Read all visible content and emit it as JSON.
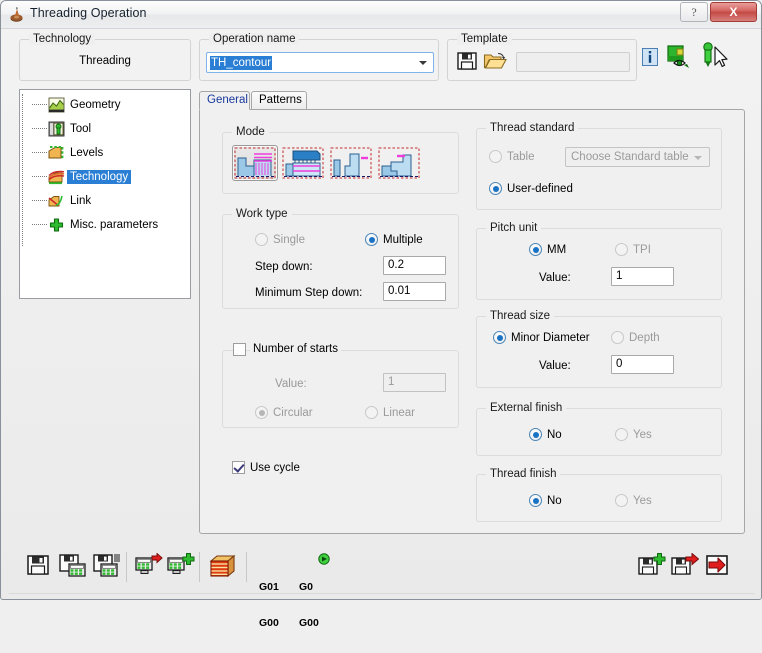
{
  "window": {
    "title": "Threading Operation",
    "icon": "threading-tool-icon",
    "help_label": "?",
    "close_label": "X"
  },
  "header": {
    "technology": {
      "label": "Technology",
      "value": "Threading"
    },
    "operation_name": {
      "label": "Operation name",
      "value": "TH_contour",
      "selected": true
    },
    "template": {
      "label": "Template",
      "field_value": "",
      "save_icon": "save-template-icon",
      "open_icon": "open-template-icon"
    },
    "icons": [
      {
        "name": "info-icon",
        "title": "Info"
      },
      {
        "name": "tool-preview-icon",
        "title": "Tool preview"
      },
      {
        "name": "pick-tool-icon",
        "title": "Pick tool"
      }
    ]
  },
  "tree": {
    "items": [
      {
        "label": "Geometry",
        "icon": "geometry-icon",
        "selected": false
      },
      {
        "label": "Tool",
        "icon": "tool-icon",
        "selected": false
      },
      {
        "label": "Levels",
        "icon": "levels-icon",
        "selected": false
      },
      {
        "label": "Technology",
        "icon": "technology-icon",
        "selected": true
      },
      {
        "label": "Link",
        "icon": "link-icon",
        "selected": false
      },
      {
        "label": "Misc. parameters",
        "icon": "misc-parameters-icon",
        "selected": false
      }
    ]
  },
  "tabs": [
    {
      "label": "General",
      "active": true
    },
    {
      "label": "Patterns",
      "active": false
    }
  ],
  "general": {
    "mode": {
      "label": "Mode",
      "options": [
        {
          "name": "mode-threading-multi-pass",
          "selected": true
        },
        {
          "name": "mode-threading-face",
          "selected": false
        },
        {
          "name": "mode-threading-internal-right",
          "selected": false
        },
        {
          "name": "mode-threading-internal-left",
          "selected": false
        }
      ]
    },
    "work_type": {
      "label": "Work type",
      "single": {
        "label": "Single",
        "checked": false,
        "enabled": false
      },
      "multiple": {
        "label": "Multiple",
        "checked": true,
        "enabled": true
      },
      "step_down": {
        "label": "Step down:",
        "value": "0.2"
      },
      "min_step_down": {
        "label": "Minimum Step down:",
        "value": "0.01"
      }
    },
    "number_of_starts": {
      "label": "Number of starts",
      "checked": false,
      "value_label": "Value:",
      "value": "1",
      "circular": {
        "label": "Circular",
        "checked": true,
        "enabled": false
      },
      "linear": {
        "label": "Linear",
        "checked": false,
        "enabled": false
      }
    },
    "use_cycle": {
      "label": "Use cycle",
      "checked": true
    },
    "thread_standard": {
      "label": "Thread standard",
      "table": {
        "label": "Table",
        "checked": false
      },
      "combo_placeholder": "Choose Standard table",
      "combo_value": "",
      "user_defined": {
        "label": "User-defined",
        "checked": true
      }
    },
    "pitch_unit": {
      "label": "Pitch unit",
      "mm": {
        "label": "MM",
        "checked": true
      },
      "tpi": {
        "label": "TPI",
        "checked": false
      },
      "value_label": "Value:",
      "value": "1"
    },
    "thread_size": {
      "label": "Thread size",
      "minor_diameter": {
        "label": "Minor Diameter",
        "checked": true
      },
      "depth": {
        "label": "Depth",
        "checked": false
      },
      "value_label": "Value:",
      "value": "0"
    },
    "external_finish": {
      "label": "External finish",
      "no": {
        "label": "No",
        "checked": true
      },
      "yes": {
        "label": "Yes",
        "checked": false
      }
    },
    "thread_finish": {
      "label": "Thread finish",
      "no": {
        "label": "No",
        "checked": true
      },
      "yes": {
        "label": "Yes",
        "checked": false
      }
    }
  },
  "toolbar": {
    "left_icons": [
      {
        "name": "save-icon",
        "title": "Save"
      },
      {
        "name": "save-calc-icon",
        "title": "Save & Calculate"
      },
      {
        "name": "save-calc-simulate-icon",
        "title": "Save, Calculate & Simulate"
      },
      {
        "name": "calculate-icon",
        "title": "Calculate"
      },
      {
        "name": "calculate-add-icon",
        "title": "Calculate and add"
      },
      {
        "name": "stock-icon",
        "title": "Stock"
      }
    ],
    "gcode_buttons": [
      {
        "name": "g01-g00-button",
        "line1": "G01",
        "line2": "G00"
      },
      {
        "name": "g0-g00-simulate-button",
        "line1": "G0",
        "line2": "G00"
      }
    ],
    "right_icons": [
      {
        "name": "save-add-icon",
        "title": "Save and add"
      },
      {
        "name": "save-exit-icon",
        "title": "Save and exit"
      },
      {
        "name": "exit-icon",
        "title": "Exit"
      }
    ]
  },
  "colors": {
    "accent": "#2a7fd4",
    "tab_active_text": "#18389c",
    "close_button": "#c44a45",
    "radio_dot": "#1a72c4"
  }
}
